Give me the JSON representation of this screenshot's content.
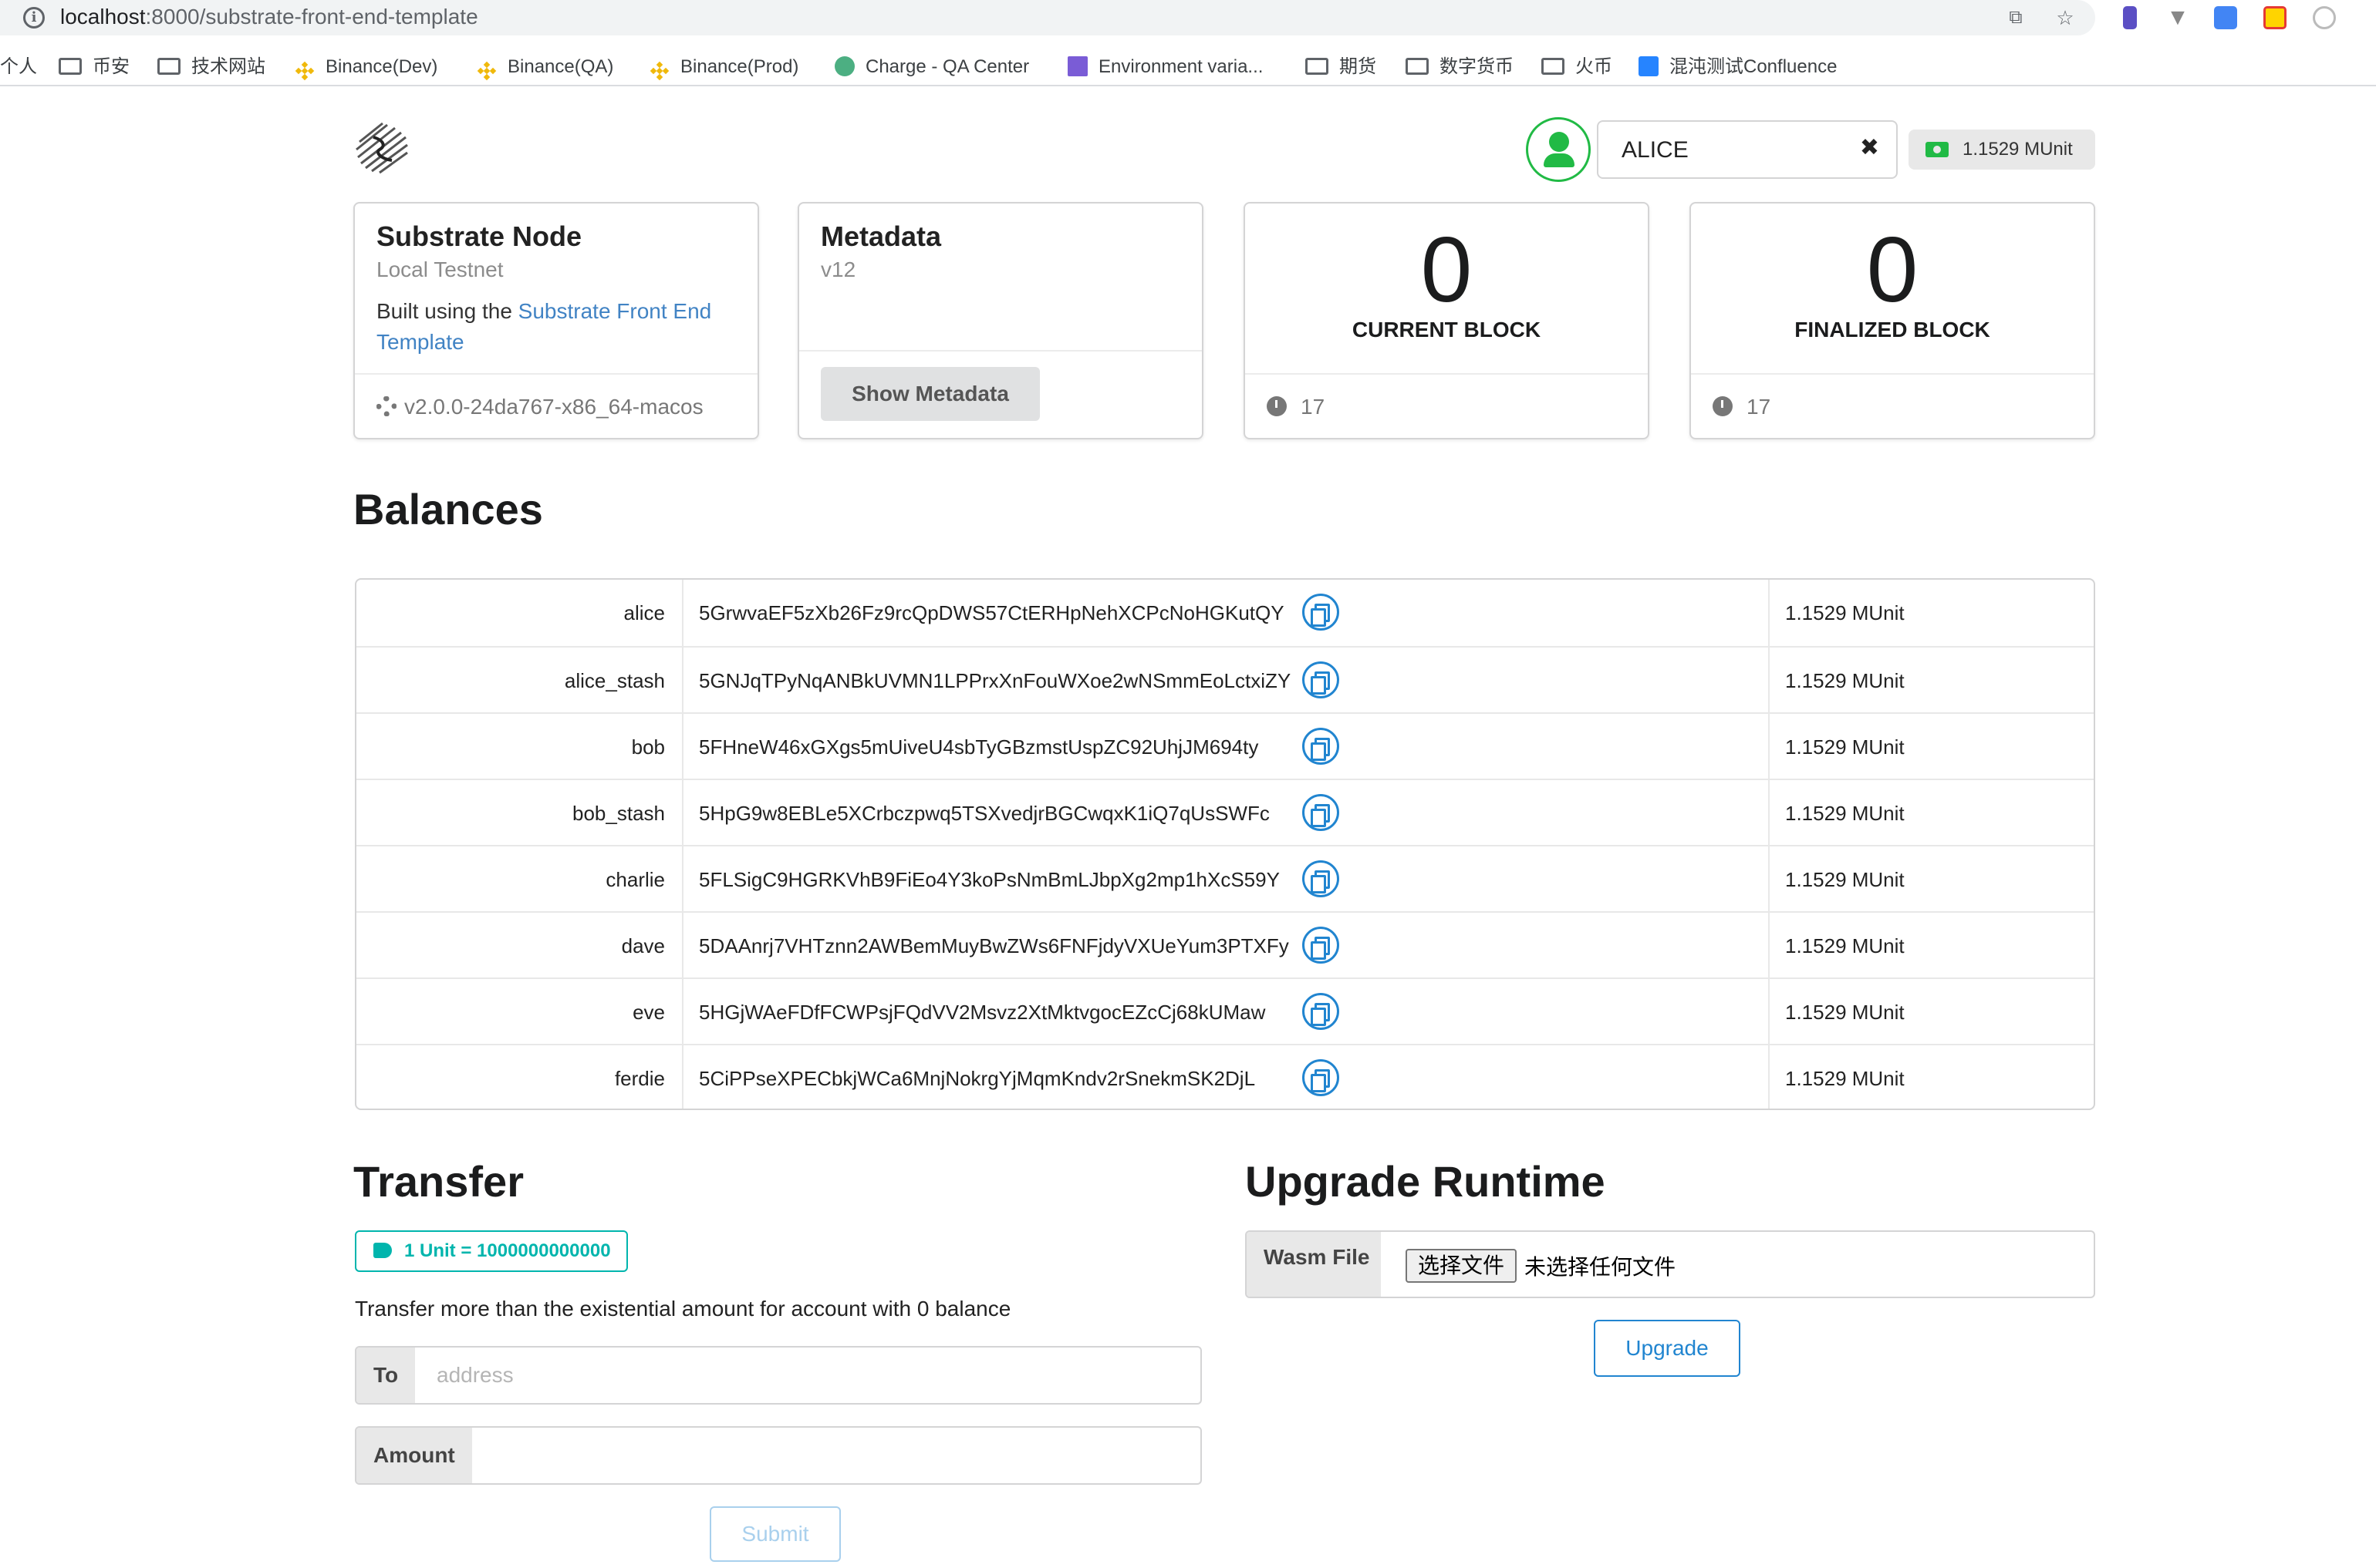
{
  "browser": {
    "url_host": "localhost",
    "url_path": ":8000/substrate-front-end-template"
  },
  "bookmarks": [
    {
      "label": "个人",
      "icon": "none"
    },
    {
      "label": "币安",
      "icon": "folder-icon"
    },
    {
      "label": "技术网站",
      "icon": "folder-icon"
    },
    {
      "label": "Binance(Dev)",
      "icon": "binance-icon"
    },
    {
      "label": "Binance(QA)",
      "icon": "binance-icon"
    },
    {
      "label": "Binance(Prod)",
      "icon": "binance-icon"
    },
    {
      "label": "Charge - QA Center",
      "icon": "charge-icon"
    },
    {
      "label": "Environment varia...",
      "icon": "environment-icon"
    },
    {
      "label": "期货",
      "icon": "folder-icon"
    },
    {
      "label": "数字货币",
      "icon": "folder-icon"
    },
    {
      "label": "火币",
      "icon": "folder-icon"
    },
    {
      "label": "混沌测试Confluence",
      "icon": "confluence-icon"
    }
  ],
  "account": {
    "selected": "ALICE",
    "clear_icon": "✖",
    "balance": "1.1529 MUnit"
  },
  "cards": {
    "node": {
      "title": "Substrate Node",
      "chain": "Local Testnet",
      "built_prefix": "Built using the ",
      "built_link": "Substrate Front End Template",
      "version": "v2.0.0-24da767-x86_64-macos"
    },
    "metadata": {
      "title": "Metadata",
      "version": "v12",
      "button": "Show Metadata"
    },
    "current_block": {
      "number": "0",
      "label": "CURRENT BLOCK",
      "timer": "17"
    },
    "finalized_block": {
      "number": "0",
      "label": "FINALIZED BLOCK",
      "timer": "17"
    }
  },
  "balances": {
    "title": "Balances",
    "rows": [
      {
        "name": "alice",
        "address": "5GrwvaEF5zXb26Fz9rcQpDWS57CtERHpNehXCPcNoHGKutQY",
        "balance": "1.1529 MUnit"
      },
      {
        "name": "alice_stash",
        "address": "5GNJqTPyNqANBkUVMN1LPPrxXnFouWXoe2wNSmmEoLctxiZY",
        "balance": "1.1529 MUnit"
      },
      {
        "name": "bob",
        "address": "5FHneW46xGXgs5mUiveU4sbTyGBzmstUspZC92UhjJM694ty",
        "balance": "1.1529 MUnit"
      },
      {
        "name": "bob_stash",
        "address": "5HpG9w8EBLe5XCrbczpwq5TSXvedjrBGCwqxK1iQ7qUsSWFc",
        "balance": "1.1529 MUnit"
      },
      {
        "name": "charlie",
        "address": "5FLSigC9HGRKVhB9FiEo4Y3koPsNmBmLJbpXg2mp1hXcS59Y",
        "balance": "1.1529 MUnit"
      },
      {
        "name": "dave",
        "address": "5DAAnrj7VHTznn2AWBemMuyBwZWs6FNFjdyVXUeYum3PTXFy",
        "balance": "1.1529 MUnit"
      },
      {
        "name": "eve",
        "address": "5HGjWAeFDfFCWPsjFQdVV2Msvz2XtMktvgocEZcCj68kUMaw",
        "balance": "1.1529 MUnit"
      },
      {
        "name": "ferdie",
        "address": "5CiPPseXPECbkjWCa6MnjNokrgYjMqmKndv2rSnekmSK2DjL",
        "balance": "1.1529 MUnit"
      }
    ]
  },
  "transfer": {
    "title": "Transfer",
    "unit_label": "1 Unit = 1000000000000",
    "note": "Transfer more than the existential amount for account with 0 balance",
    "to_label": "To",
    "to_placeholder": "address",
    "to_value": "",
    "amount_label": "Amount",
    "amount_value": "",
    "submit": "Submit"
  },
  "upgrade": {
    "title": "Upgrade Runtime",
    "wasm_label": "Wasm File",
    "file_button": "选择文件",
    "file_status": "未选择任何文件",
    "button": "Upgrade"
  },
  "colors": {
    "green": "#21ba45",
    "blue": "#2185d0",
    "teal": "#00b5ad",
    "link": "#4183c4"
  }
}
